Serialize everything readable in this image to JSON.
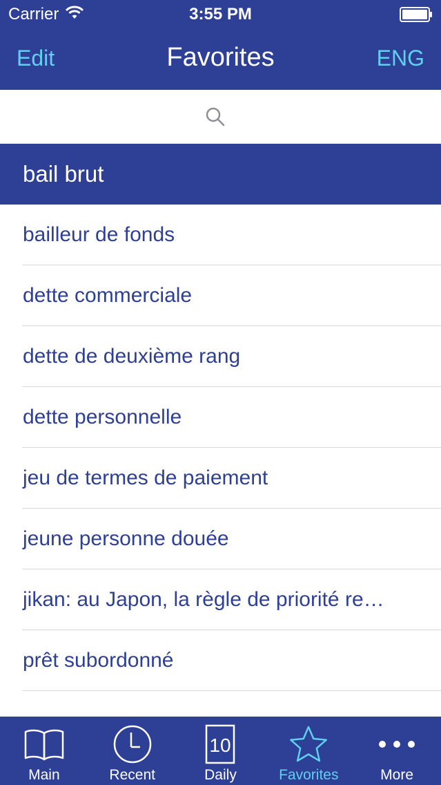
{
  "status_bar": {
    "carrier": "Carrier",
    "time": "3:55 PM"
  },
  "nav": {
    "edit_label": "Edit",
    "title": "Favorites",
    "lang_label": "ENG"
  },
  "items": [
    {
      "label": "bail brut",
      "selected": true
    },
    {
      "label": "bailleur de fonds",
      "selected": false
    },
    {
      "label": "dette commerciale",
      "selected": false
    },
    {
      "label": "dette de deuxième rang",
      "selected": false
    },
    {
      "label": "dette personnelle",
      "selected": false
    },
    {
      "label": "jeu de termes de paiement",
      "selected": false
    },
    {
      "label": "jeune personne douée",
      "selected": false
    },
    {
      "label": "jikan: au Japon, la règle de priorité re…",
      "selected": false
    },
    {
      "label": "prêt subordonné",
      "selected": false
    }
  ],
  "tabs": [
    {
      "label": "Main",
      "icon": "book-icon",
      "active": false
    },
    {
      "label": "Recent",
      "icon": "clock-icon",
      "active": false
    },
    {
      "label": "Daily",
      "icon": "calendar-icon",
      "day": "10",
      "active": false
    },
    {
      "label": "Favorites",
      "icon": "star-icon",
      "active": true
    },
    {
      "label": "More",
      "icon": "more-icon",
      "active": false
    }
  ],
  "colors": {
    "primary": "#2e3f96",
    "accent": "#5fd0ee",
    "list_text": "#2e3f96",
    "separator": "#d6d6d6"
  }
}
